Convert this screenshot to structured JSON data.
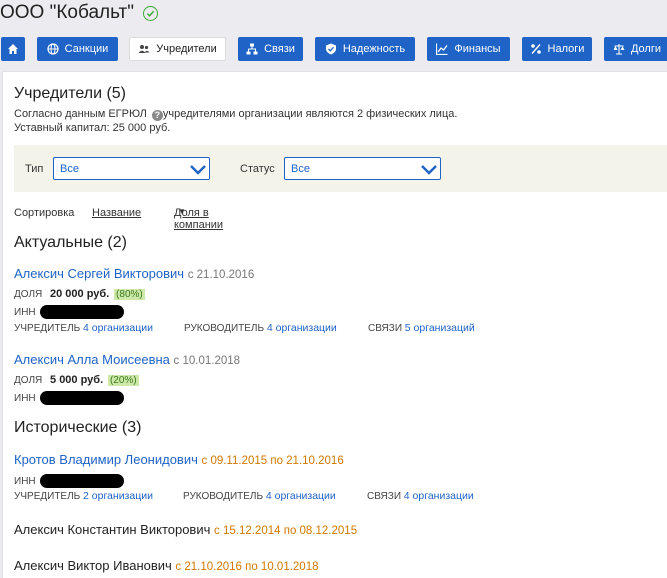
{
  "company": {
    "name": "ООО \"Кобальт\""
  },
  "nav": {
    "sanctions": "Санкции",
    "founders": "Учредители",
    "links": "Связи",
    "reliability": "Надежность",
    "finance": "Финансы",
    "taxes": "Налоги",
    "debts": "Долги"
  },
  "section": {
    "title": "Учредители (5)",
    "desc_part1": "Согласно данным ЕГРЮЛ",
    "help_glyph": "?",
    "desc_part2": "учредителями организации являются 2 физических лица.",
    "capital": "Уставный капитал: 25 000 руб."
  },
  "filters": {
    "type_label": "Тип",
    "type_value": "Все",
    "status_label": "Статус",
    "status_value": "Все"
  },
  "sort": {
    "label": "Сортировка",
    "by_name": "Название",
    "by_share": "Доля в компании"
  },
  "labels": {
    "share": "ДОЛЯ",
    "inn": "ИНН",
    "founder": "УЧРЕДИТЕЛЬ",
    "manager": "РУКОВОДИТЕЛЬ",
    "links": "СВЯЗИ"
  },
  "actual": {
    "title": "Актуальные (2)",
    "people": [
      {
        "name": "Алексич Сергей Викторович",
        "date": "с 21.10.2016",
        "share": "20 000 руб.",
        "share_pct": "(80%)",
        "founder_link": "4 организации",
        "manager_link": "4 организации",
        "links_link": "5 организаций"
      },
      {
        "name": "Алексич Алла Моисеевна",
        "date": "с 10.01.2018",
        "share": "5 000 руб.",
        "share_pct": "(20%)"
      }
    ]
  },
  "historical": {
    "title": "Исторические (3)",
    "people": [
      {
        "name": "Кротов Владимир Леонидович",
        "date": "с 09.11.2015 по 21.10.2016",
        "founder_link": "2 организации",
        "manager_link": "4 организации",
        "links_link": "4 организации"
      },
      {
        "name": "Алексич Константин Викторович",
        "date": "с 15.12.2014 по 08.12.2015"
      },
      {
        "name": "Алексич Виктор Иванович",
        "date": "с 21.10.2016 по 10.01.2018"
      }
    ]
  },
  "colors": {
    "brand_blue": "#1f63c6",
    "orange": "#d07800",
    "green": "#3aaa35"
  }
}
